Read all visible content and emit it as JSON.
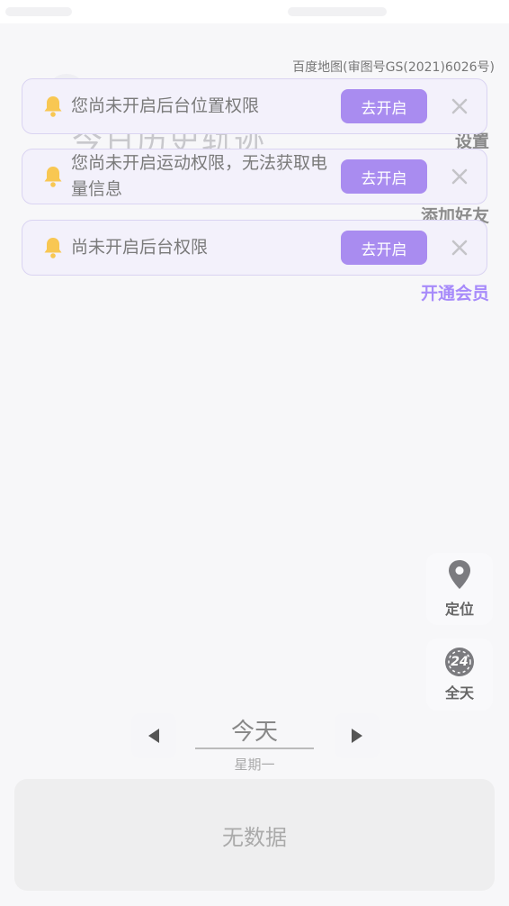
{
  "map": {
    "credit": "百度地图(审图号GS(2021)6026号)"
  },
  "page": {
    "title": "今日历史轨迹"
  },
  "side_links": {
    "settings": "设置",
    "add_friend": "添加好友",
    "vip": "开通会员"
  },
  "notices": [
    {
      "message": "您尚未开启后台位置权限",
      "button": "去开启"
    },
    {
      "message": "您尚未开启运动权限，无法获取电量信息",
      "button": "去开启"
    },
    {
      "message": "尚未开启后台权限",
      "button": "去开启"
    }
  ],
  "floating_buttons": {
    "locate": "定位",
    "all_day": "全天",
    "all_day_badge": "24"
  },
  "date_nav": {
    "date": "今天",
    "weekday": "星期一"
  },
  "panel": {
    "empty_text": "无数据"
  },
  "colors": {
    "accent": "#a98cf0",
    "bell": "#f8c752",
    "vip_text": "#a78bfa"
  },
  "icons": {
    "notice": "bell-icon",
    "close": "close-icon",
    "locate": "location-pin-icon",
    "all_day": "clock-24-icon",
    "prev": "triangle-left-icon",
    "next": "triangle-right-icon"
  }
}
